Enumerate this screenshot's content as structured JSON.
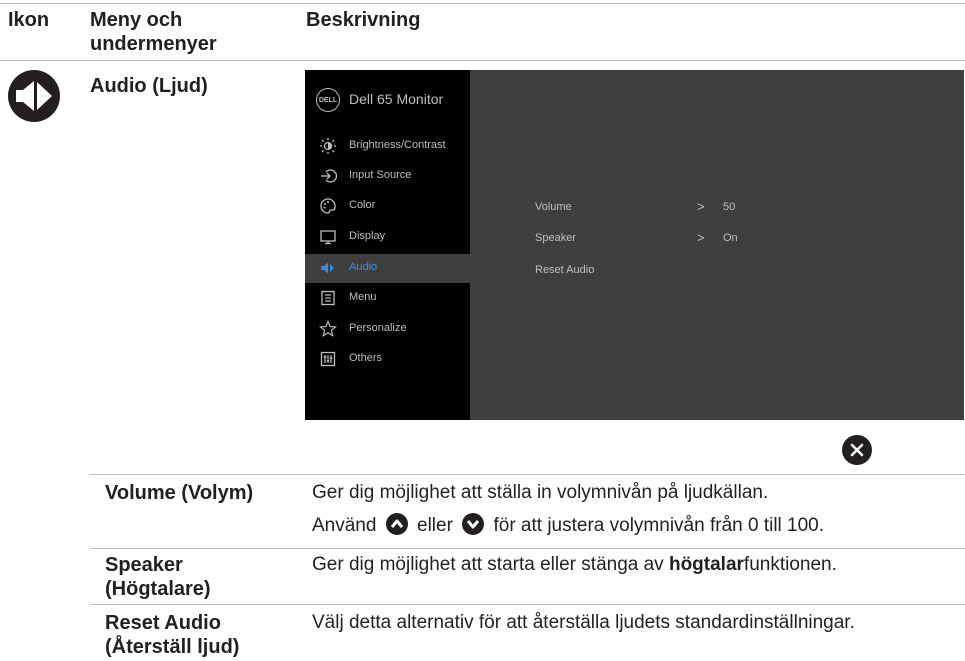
{
  "header": {
    "col1": "Ikon",
    "col2_line1": "Meny och",
    "col2_line2": "undermenyer",
    "col3": "Beskrivning"
  },
  "section_title": "Audio (Ljud)",
  "osd": {
    "title": "Dell 65 Monitor",
    "logo": "DELL",
    "menu": [
      {
        "label": "Brightness/Contrast",
        "icon": "brightness-icon"
      },
      {
        "label": "Input Source",
        "icon": "input-source-icon"
      },
      {
        "label": "Color",
        "icon": "color-palette-icon"
      },
      {
        "label": "Display",
        "icon": "display-icon"
      },
      {
        "label": "Audio",
        "icon": "speaker-icon",
        "selected": true
      },
      {
        "label": "Menu",
        "icon": "menu-icon"
      },
      {
        "label": "Personalize",
        "icon": "star-icon"
      },
      {
        "label": "Others",
        "icon": "others-icon"
      }
    ],
    "options": [
      {
        "label": "Volume",
        "value": "50"
      },
      {
        "label": "Speaker",
        "value": "On"
      },
      {
        "label": "Reset Audio",
        "value": ""
      }
    ],
    "selected_color": "#3c8bd6"
  },
  "rows": [
    {
      "name": "Volume (Volym)",
      "line1": "Ger dig möjlighet att ställa in volymnivån på ljudkällan.",
      "line2_a": "Använd",
      "line2_b": "eller",
      "line2_c": "för att justera volymnivån från 0 till 100."
    },
    {
      "name_line1": "Speaker",
      "name_line2": "(Högtalare)",
      "desc_a": "Ger dig möjlighet att starta eller stänga av ",
      "desc_bold": "högtalar",
      "desc_c": "funktionen."
    },
    {
      "name_line1": "Reset Audio",
      "name_line2": "(Återställ ljud)",
      "desc": "Välj detta alternativ för att återställa ljudets standardinställningar."
    }
  ]
}
